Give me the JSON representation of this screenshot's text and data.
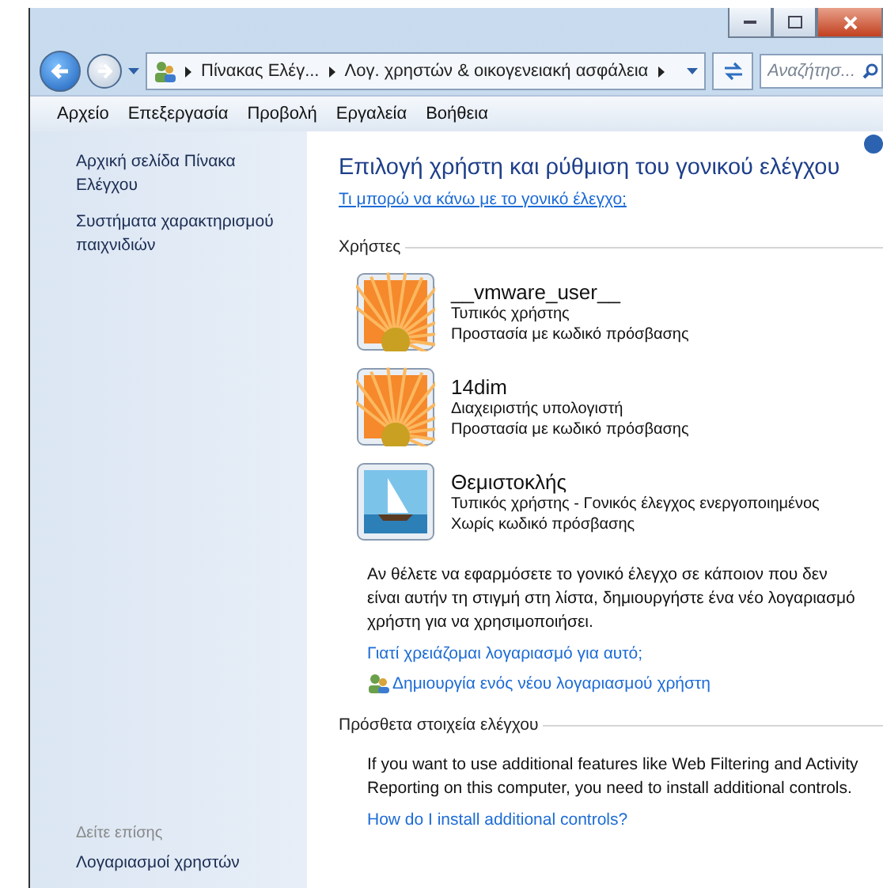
{
  "address_bar": {
    "breadcrumbs": [
      "Πίνακας Ελέγ...",
      "Λογ. χρηστών & οικογενειακή ασφάλεια"
    ],
    "search": {
      "placeholder": "Αναζήτησ..."
    }
  },
  "menu": [
    "Αρχείο",
    "Επεξεργασία",
    "Προβολή",
    "Εργαλεία",
    "Βοήθεια"
  ],
  "sidebar": {
    "links": [
      "Αρχική σελίδα Πίνακα Ελέγχου",
      "Συστήματα χαρακτηρισμού παιχνιδιών"
    ],
    "see_also_title": "Δείτε επίσης",
    "see_also": [
      "Λογαριασμοί χρηστών"
    ]
  },
  "main": {
    "title": "Επιλογή χρήστη και ρύθμιση του γονικού ελέγχου",
    "help_link": "Τι μπορώ να κάνω με το γονικό έλεγχο;",
    "users_heading": "Χρήστες",
    "users": [
      {
        "name": "__vmware_user__",
        "kind": "flower",
        "lines": [
          "Τυπικός χρήστης",
          "Προστασία με κωδικό πρόσβασης"
        ]
      },
      {
        "name": "14dim",
        "kind": "flower",
        "lines": [
          "Διαχειριστής υπολογιστή",
          "Προστασία με κωδικό πρόσβασης"
        ]
      },
      {
        "name": "Θεμιστοκλής",
        "kind": "sailboat",
        "lines": [
          "Τυπικός χρήστης - Γονικός έλεγχος ενεργοποιημένος",
          "Χωρίς κωδικό πρόσβασης"
        ]
      }
    ],
    "info": "Αν θέλετε να εφαρμόσετε το γονικό έλεγχο σε κάποιον που δεν είναι αυτήν τη στιγμή στη λίστα, δημιουργήστε ένα νέο λογαριασμό χρήστη για να χρησιμοποιήσει.",
    "why_link": "Γιατί χρειάζομαι λογαριασμό για αυτό;",
    "create_link": "Δημιουργία ενός νέου λογαριασμού χρήστη",
    "controls_heading": "Πρόσθετα στοιχεία ελέγχου",
    "controls_text": "If you want to use additional features like Web Filtering and Activity Reporting on this computer, you need to install additional controls.",
    "controls_link": "How do I install additional controls?"
  }
}
